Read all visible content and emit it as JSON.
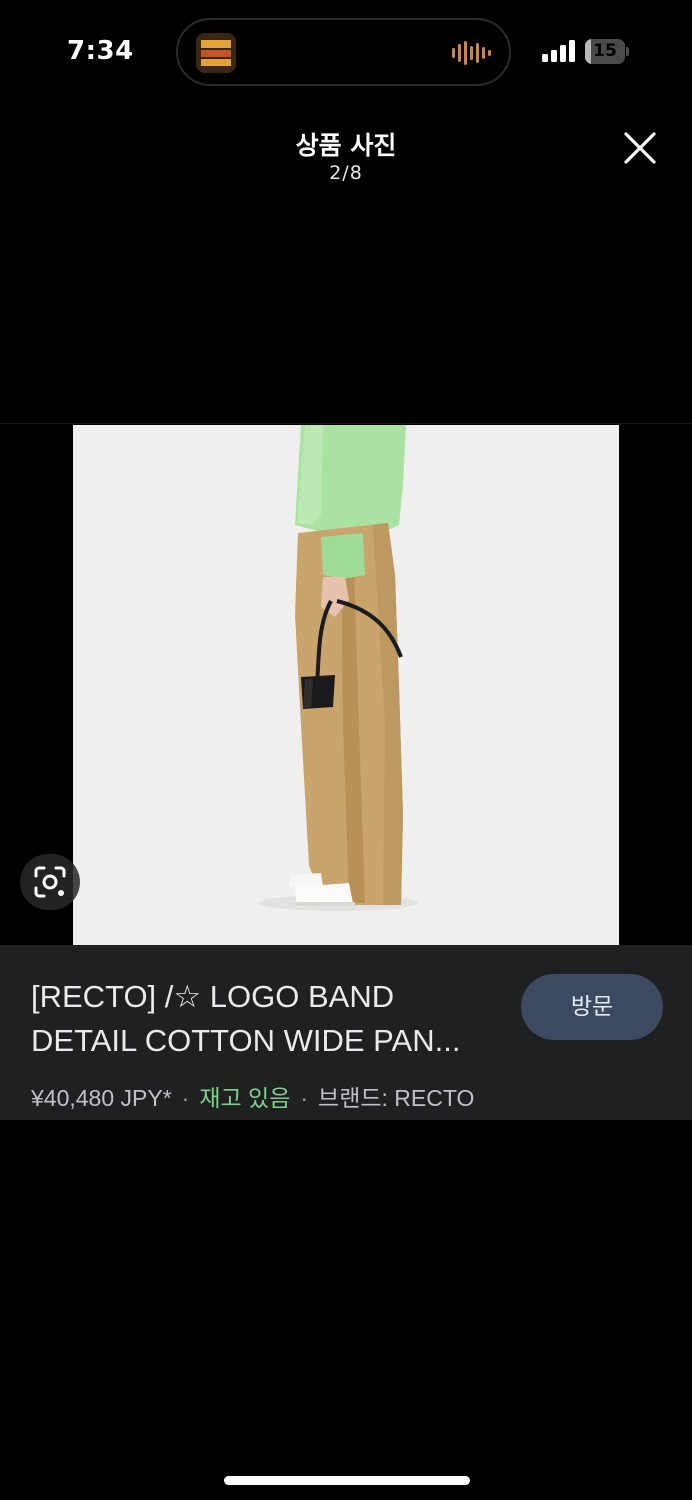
{
  "status_bar": {
    "time": "7:34",
    "battery_level": 15,
    "battery_label": "15",
    "icons": [
      "app-thumbnail-icon",
      "audio-waveform-icon",
      "cellular-signal-icon",
      "battery-icon"
    ]
  },
  "header": {
    "title": "상품 사진",
    "counter": "2/8",
    "close_icon": "close-icon"
  },
  "image": {
    "description_icon": "lens-search-icon"
  },
  "product": {
    "title_line1": "[RECTO] /☆ LOGO BAND",
    "title_line2": "DETAIL COTTON WIDE PAN...",
    "price": "¥40,480 JPY*",
    "separator": "·",
    "stock": "재고 있음",
    "brand": "브랜드: RECTO",
    "visit_label": "방문"
  },
  "colors": {
    "background": "#000000",
    "panel": "#1f2022",
    "visit_button": "#3c4a61",
    "stock_green": "#82cf8c"
  }
}
